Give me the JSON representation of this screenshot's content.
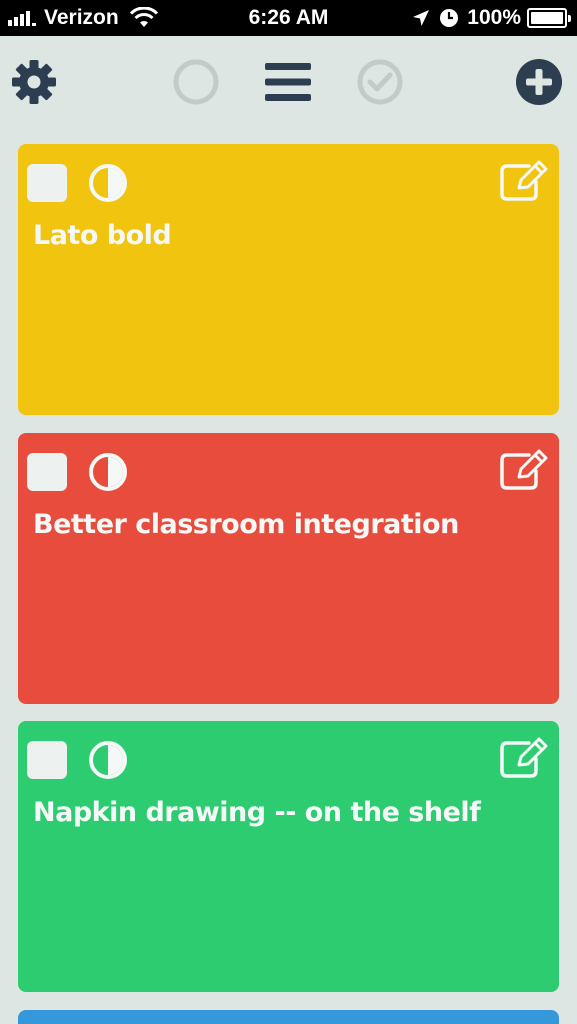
{
  "status_bar": {
    "carrier": "Verizon",
    "time": "6:26 AM",
    "battery": "100%"
  },
  "toolbar": {
    "settings_icon": "gear-icon",
    "filter_open_icon": "circle-icon",
    "list_icon": "menu-icon",
    "filter_done_icon": "check-circle-icon",
    "add_icon": "plus-circle-icon"
  },
  "colors": {
    "background": "#dde6e3",
    "icon": "#2c3e50",
    "icon_faded": "#c3cbca",
    "yellow": "#f1c40f",
    "red": "#e74c3c",
    "green": "#2ecc71",
    "blue": "#3498db"
  },
  "cards": [
    {
      "title": "Lato bold",
      "color": "#f1c40f"
    },
    {
      "title": "Better classroom integration",
      "color": "#e74c3c"
    },
    {
      "title": "Napkin drawing -- on the shelf",
      "color": "#2ecc71"
    }
  ]
}
